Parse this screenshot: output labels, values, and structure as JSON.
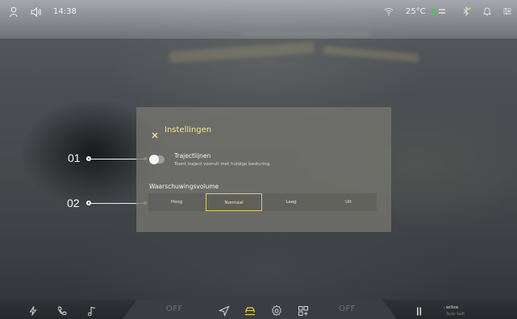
{
  "status_bar": {
    "time": "14:38",
    "temperature": "25°C",
    "icons": [
      "person-icon",
      "volume-icon",
      "wifi-icon",
      "air-quality-icon",
      "bluetooth-icon",
      "notification-bell-icon",
      "settings-sliders-icon"
    ]
  },
  "dialog": {
    "close_icon": "close-icon",
    "title": "Instellingen",
    "toggle": {
      "title": "Trajectlijnen",
      "description": "Toont traject vooruit met huidige besturing.",
      "state": "off"
    },
    "volume": {
      "label": "Waarschuwingsvolume",
      "options": [
        "Hoog",
        "Normaal",
        "Laag",
        "Uit"
      ],
      "selected": "Normaal"
    }
  },
  "callouts": [
    "01",
    "02"
  ],
  "bottom_nav": {
    "left_icons": [
      "charging-icon",
      "phone-icon",
      "music-icon"
    ],
    "off_left": "OFF",
    "off_right": "OFF",
    "center_icons": [
      "navigation-icon",
      "car-icon",
      "settings-gear-icon",
      "apps-grid-icon"
    ],
    "media": {
      "icon": "media-bars-icon",
      "title": "willow",
      "artist": "Taylor Swift"
    }
  },
  "colors": {
    "accent": "#e3d64a",
    "accent_text": "#f3e98b",
    "dialog_bg": "#76766f"
  }
}
